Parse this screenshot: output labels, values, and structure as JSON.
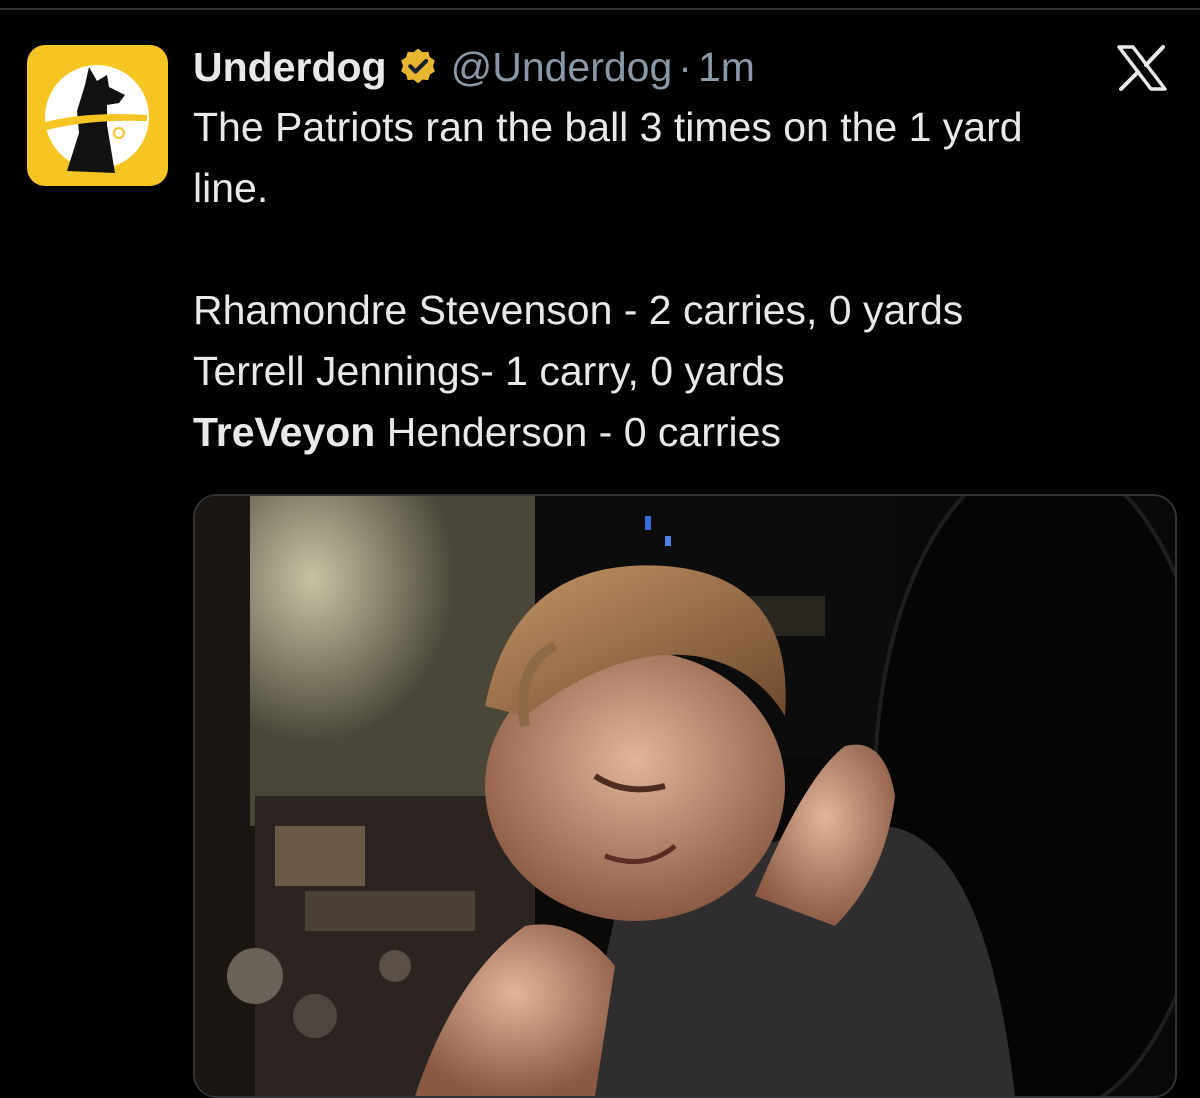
{
  "tweet": {
    "display_name": "Underdog",
    "verified": true,
    "verified_badge_color": "#e8b731",
    "handle": "@Underdog",
    "separator": "·",
    "timestamp": "1m",
    "lines": [
      "The Patriots ran the ball 3 times on the 1 yard",
      "line."
    ],
    "stats": [
      "Rhamondre Stevenson - 2 carries, 0 yards",
      "Terrell Jennings- 1 carry, 0 yards"
    ],
    "last_stat_bold": "TreVeyon",
    "last_stat_rest": " Henderson - 0 carries"
  },
  "avatar": {
    "icon": "underdog-dog-logo",
    "background_color": "#f5c623"
  },
  "x_logo_icon": "x-logo",
  "media": {
    "description_icon": "tweet-photo"
  },
  "colors": {
    "background": "#000000",
    "primary_text": "#e7e9ea",
    "secondary_text": "#8b98a5",
    "border": "#2f3336"
  }
}
